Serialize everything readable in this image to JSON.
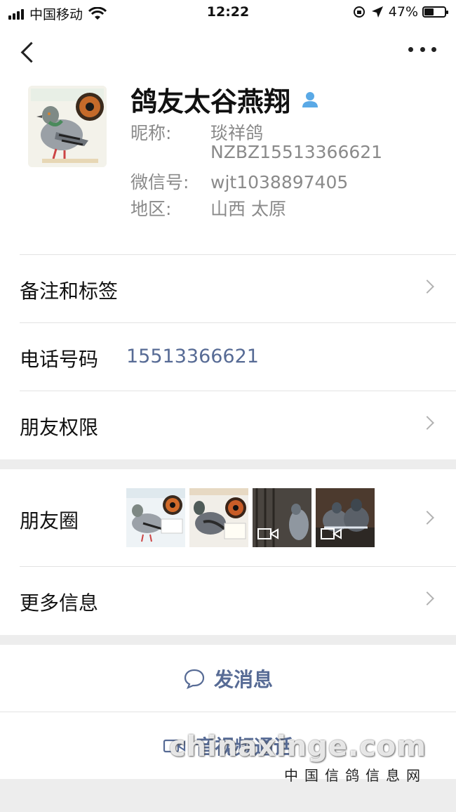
{
  "status_bar": {
    "carrier": "中国移动",
    "time": "12:22",
    "battery": "47%",
    "battery_level": 0.47
  },
  "profile": {
    "name": "鸽友太谷燕翔",
    "nickname_label": "昵称:",
    "nickname_line1": "琰祥鸽",
    "nickname_line2": "NZBZ15513366621",
    "wechat_label": "微信号:",
    "wechat_id": "wjt1038897405",
    "region_label": "地区:",
    "region": "山西 太原"
  },
  "list": {
    "remarks_label": "备注和标签",
    "phone_label": "电话号码",
    "phone_value": "15513366621",
    "permissions_label": "朋友权限",
    "moments_label": "朋友圈",
    "more_info_label": "更多信息"
  },
  "actions": {
    "message": "发消息",
    "av_call": "音视频通话"
  },
  "watermark": {
    "main": "chinaxinge.com",
    "sub": "中国信鸽信息网"
  },
  "colors": {
    "link": "#576b95",
    "verified": "#5aa9e6"
  }
}
